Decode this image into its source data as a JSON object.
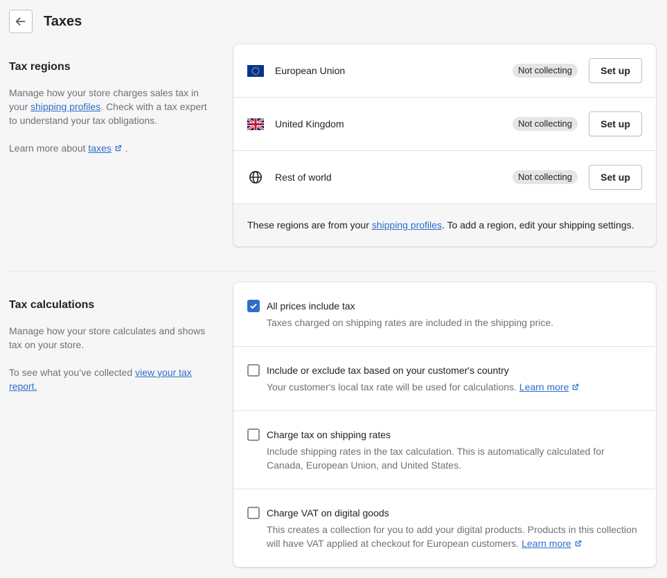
{
  "header": {
    "title": "Taxes",
    "back_icon": "arrow-left-icon"
  },
  "tax_regions": {
    "title": "Tax regions",
    "description_before": "Manage how your store charges sales tax in your ",
    "description_link": "shipping profiles",
    "description_after": ". Check with a tax expert to understand your tax obligations.",
    "learn_before": "Learn more about ",
    "learn_link": "taxes",
    "learn_after": " .",
    "regions": [
      {
        "name": "European Union",
        "icon": "eu-flag-icon",
        "status": "Not collecting",
        "action": "Set up"
      },
      {
        "name": "United Kingdom",
        "icon": "uk-flag-icon",
        "status": "Not collecting",
        "action": "Set up"
      },
      {
        "name": "Rest of world",
        "icon": "globe-icon",
        "status": "Not collecting",
        "action": "Set up"
      }
    ],
    "footer_before": "These regions are from your ",
    "footer_link": "shipping profiles",
    "footer_after": ". To add a region, edit your shipping settings."
  },
  "tax_calculations": {
    "title": "Tax calculations",
    "description": "Manage how your store calculates and shows tax on your store.",
    "report_before": "To see what you’ve collected ",
    "report_link": "view your tax report.",
    "options": [
      {
        "label": "All prices include tax",
        "help": "Taxes charged on shipping rates are included in the shipping price.",
        "checked": true
      },
      {
        "label": "Include or exclude tax based on your customer's country",
        "help": "Your customer's local tax rate will be used for calculations.",
        "help_link": "Learn more",
        "checked": false
      },
      {
        "label": "Charge tax on shipping rates",
        "help": "Include shipping rates in the tax calculation. This is automatically calculated for Canada, European Union, and United States.",
        "checked": false
      },
      {
        "label": "Charge VAT on digital goods",
        "help": "This creates a collection for you to add your digital products. Products in this collection will have VAT applied at checkout for European customers.",
        "help_link": "Learn more",
        "checked": false
      }
    ]
  },
  "colors": {
    "accent": "#2c6ecb",
    "badge_bg": "#e4e5e7",
    "page_bg": "#f6f6f7"
  }
}
